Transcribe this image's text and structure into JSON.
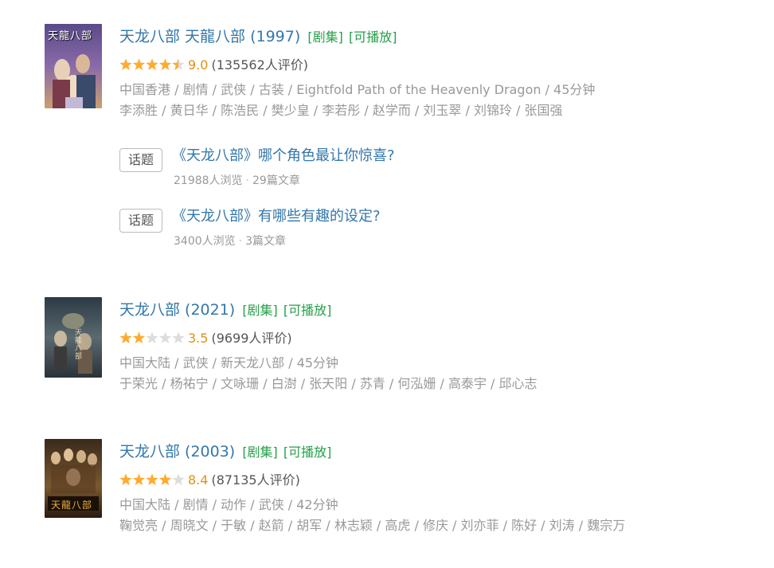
{
  "results": [
    {
      "title": "天龙八部 天龍八部 (1997)",
      "tags": [
        "[剧集]",
        "[可播放]"
      ],
      "stars": 4.5,
      "score": "9.0",
      "votes": "(135562人评价)",
      "meta_line1": "中国香港 / 剧情 / 武侠 / 古装 / Eightfold Path of the Heavenly Dragon / 45分钟",
      "meta_line2": "李添胜 / 黄日华 / 陈浩民 / 樊少皇 / 李若彤 / 赵学而 / 刘玉翠 / 刘锦玲 / 张国强",
      "poster_text": "天龍八部",
      "topics": [
        {
          "badge": "话题",
          "title": "《天龙八部》哪个角色最让你惊喜?",
          "views": "21988人浏览",
          "articles": "29篇文章"
        },
        {
          "badge": "话题",
          "title": "《天龙八部》有哪些有趣的设定?",
          "views": "3400人浏览",
          "articles": "3篇文章"
        }
      ]
    },
    {
      "title": "天龙八部 (2021)",
      "tags": [
        "[剧集]",
        "[可播放]"
      ],
      "stars": 2,
      "score": "3.5",
      "votes": "(9699人评价)",
      "meta_line1": "中国大陆 / 武侠 / 新天龙八部 / 45分钟",
      "meta_line2": "于荣光 / 杨祐宁 / 文咏珊 / 白澍 / 张天阳 / 苏青 / 何泓姗 / 高泰宇 / 邱心志",
      "poster_text": "天龍八部"
    },
    {
      "title": "天龙八部 (2003)",
      "tags": [
        "[剧集]",
        "[可播放]"
      ],
      "stars": 4,
      "score": "8.4",
      "votes": "(87135人评价)",
      "meta_line1": "中国大陆 / 剧情 / 动作 / 武侠 / 42分钟",
      "meta_line2": "鞠觉亮 / 周晓文 / 于敏 / 赵箭 / 胡军 / 林志颖 / 高虎 / 修庆 / 刘亦菲 / 陈好 / 刘涛 / 魏宗万",
      "poster_text": "天龍八部"
    }
  ],
  "colors": {
    "title": "#3377aa",
    "tag": "#26a04a",
    "score": "#e09015",
    "star_on": "#ffac2d",
    "star_off": "#dddddd",
    "meta": "#999999"
  }
}
